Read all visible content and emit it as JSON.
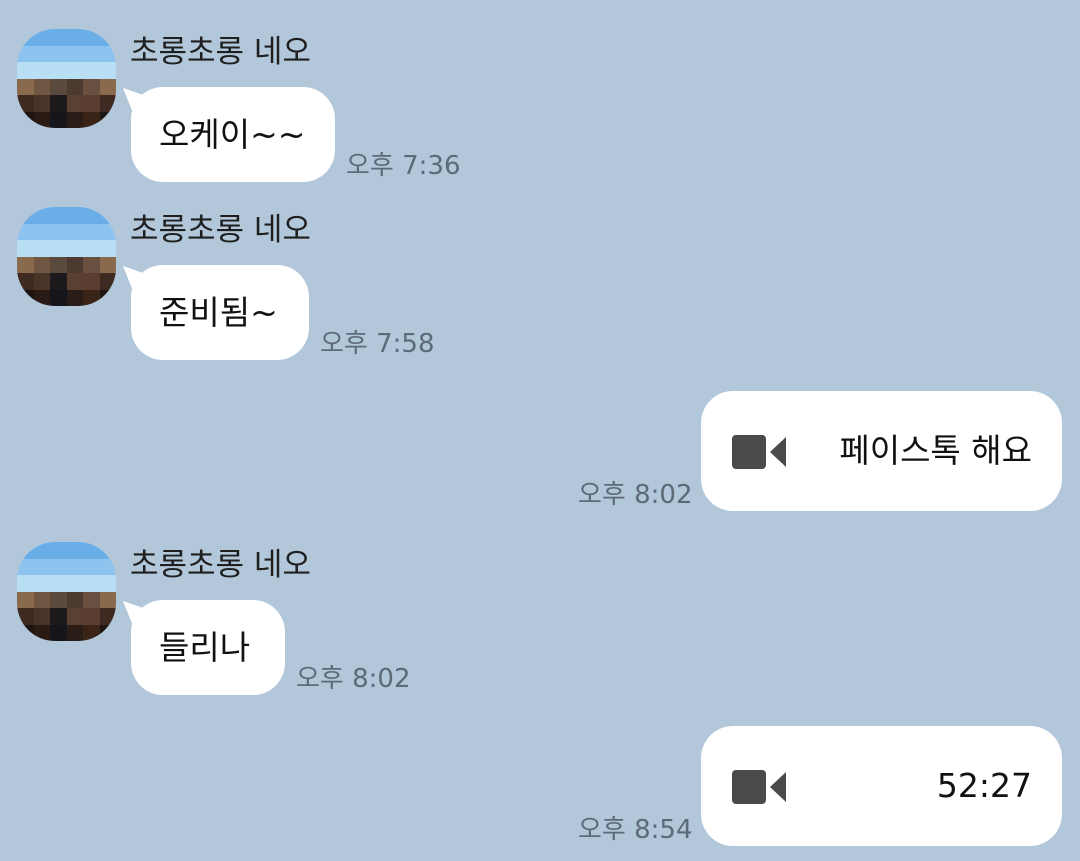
{
  "messages": [
    {
      "sender": "초롱초롱 네오",
      "text": "오케이~~",
      "time": "오후 7:36"
    },
    {
      "sender": "초롱초롱 네오",
      "text": "준비됨~",
      "time": "오후 7:58"
    },
    {
      "text": "페이스톡 해요",
      "time": "오후 8:02",
      "icon": "video-camera-icon"
    },
    {
      "sender": "초롱초롱 네오",
      "text": "들리나",
      "time": "오후 8:02"
    },
    {
      "text": "52:27",
      "time": "오후 8:54",
      "icon": "video-camera-icon"
    }
  ],
  "colors": {
    "background": "#b2c7da",
    "bubble": "#ffffff",
    "time_text": "#5d6a78",
    "icon": "#4a4a4a"
  }
}
